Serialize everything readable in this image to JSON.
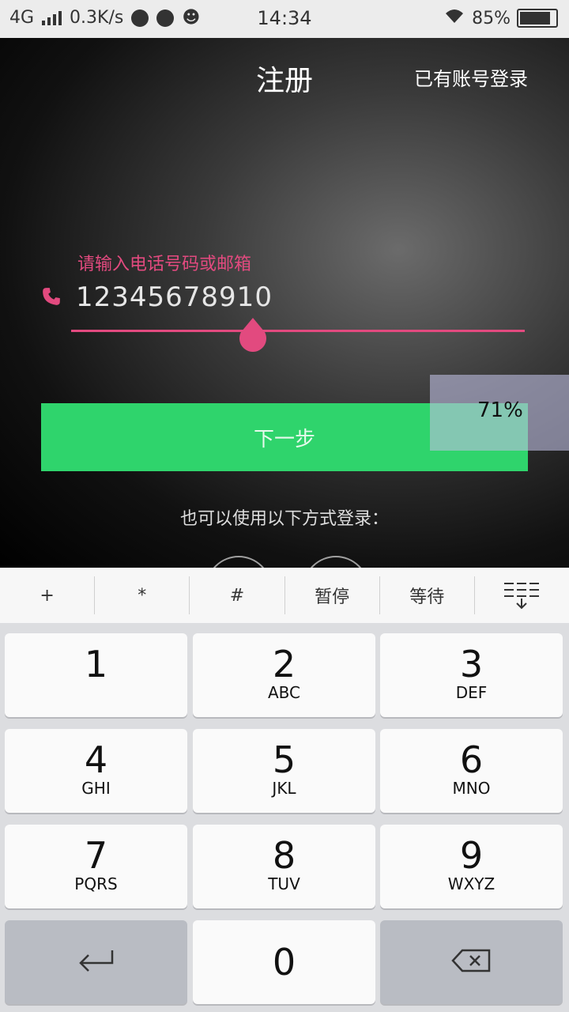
{
  "status_bar": {
    "network": "4G",
    "speed": "0.3K/s",
    "time": "14:34",
    "battery_percent": "85%"
  },
  "header": {
    "title": "注册",
    "login_link": "已有账号登录"
  },
  "form": {
    "label": "请输入电话号码或邮箱",
    "phone_value": "12345678910",
    "next_button": "下一步"
  },
  "overlay": {
    "progress_text": "71%"
  },
  "alt_login_text": "也可以使用以下方式登录：",
  "keyboard": {
    "toolbar": [
      "+",
      "*",
      "#",
      "暂停",
      "等待"
    ],
    "keys": [
      {
        "num": "1",
        "sub": ""
      },
      {
        "num": "2",
        "sub": "ABC"
      },
      {
        "num": "3",
        "sub": "DEF"
      },
      {
        "num": "4",
        "sub": "GHI"
      },
      {
        "num": "5",
        "sub": "JKL"
      },
      {
        "num": "6",
        "sub": "MNO"
      },
      {
        "num": "7",
        "sub": "PQRS"
      },
      {
        "num": "8",
        "sub": "TUV"
      },
      {
        "num": "9",
        "sub": "WXYZ"
      },
      {
        "num": "0",
        "sub": ""
      }
    ]
  },
  "colors": {
    "accent": "#e24a7f",
    "button": "#2fd46c"
  }
}
